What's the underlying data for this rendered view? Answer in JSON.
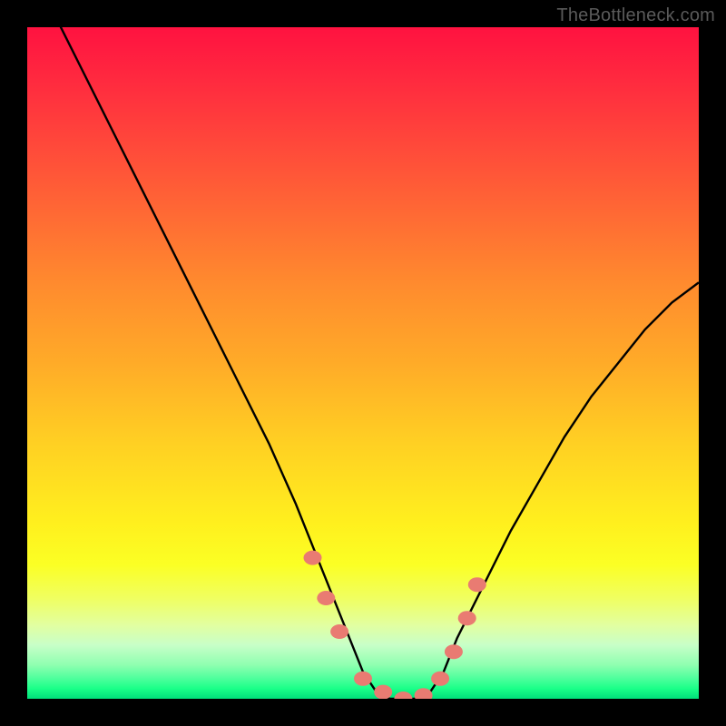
{
  "watermark": "TheBottleneck.com",
  "colors": {
    "frame": "#000000",
    "curve": "#000000",
    "marker": "#e97b72",
    "gradient_top": "#ff1240",
    "gradient_bottom": "#00de7a"
  },
  "chart_data": {
    "type": "line",
    "title": "",
    "xlabel": "",
    "ylabel": "",
    "xlim": [
      0,
      100
    ],
    "ylim": [
      0,
      100
    ],
    "grid": false,
    "legend": false,
    "series": [
      {
        "name": "bottleneck-curve",
        "x": [
          0,
          4,
          8,
          12,
          16,
          20,
          24,
          28,
          32,
          36,
          40,
          42,
          44,
          46,
          48,
          50,
          52,
          54,
          56,
          58,
          60,
          62,
          64,
          68,
          72,
          76,
          80,
          84,
          88,
          92,
          96,
          100
        ],
        "y": [
          110,
          102,
          94,
          86,
          78,
          70,
          62,
          54,
          46,
          38,
          29,
          24,
          19,
          14,
          9,
          4,
          1,
          0,
          0,
          0,
          1,
          4,
          9,
          17,
          25,
          32,
          39,
          45,
          50,
          55,
          59,
          62
        ]
      }
    ],
    "markers": {
      "name": "highlight-points",
      "x": [
        42.5,
        44.5,
        46.5,
        50,
        53,
        56,
        59,
        61.5,
        63.5,
        65.5,
        67.0
      ],
      "y": [
        21,
        15,
        10,
        3,
        1,
        0,
        0.5,
        3,
        7,
        12,
        17
      ]
    },
    "annotations": []
  }
}
